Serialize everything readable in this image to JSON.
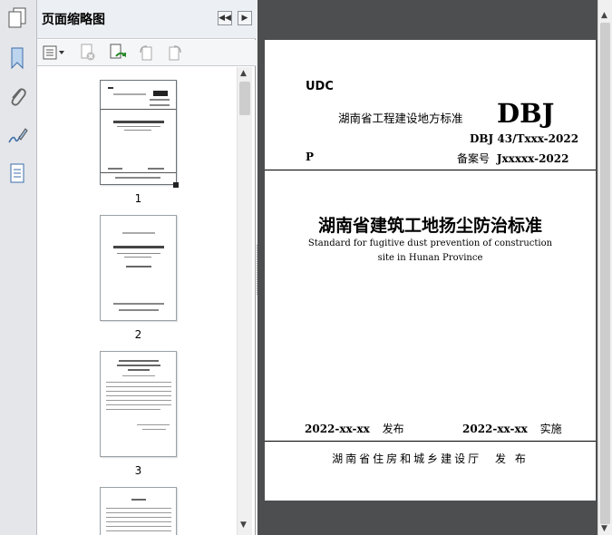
{
  "panel": {
    "title": "页面缩略图"
  },
  "thumbnails": [
    {
      "page": "1"
    },
    {
      "page": "2"
    },
    {
      "page": "3"
    }
  ],
  "document": {
    "udc": "UDC",
    "series": "湖南省工程建设地方标准",
    "logo": "DBJ",
    "std_no": "DBJ 43/Txxx-2022",
    "p": "P",
    "record_label": "备案号",
    "record_no": "Jxxxxx-2022",
    "title": "湖南省建筑工地扬尘防治标准",
    "title_en_1": "Standard for fugitive dust prevention of construction",
    "title_en_2": "site in Hunan Province",
    "issue_date": "2022-xx-xx",
    "issue_word": "发布",
    "impl_date": "2022-xx-xx",
    "impl_word": "实施",
    "publisher": "湖南省住房和城乡建设厅",
    "publisher_word": "发 布"
  },
  "icons": [
    "pages-icon",
    "bookmark-icon",
    "attachment-icon",
    "signature-icon",
    "layers-icon",
    "options-icon",
    "delete-page-icon",
    "insert-page-icon",
    "rotate-left-icon",
    "rotate-right-icon",
    "collapse-left-icon",
    "expand-right-icon"
  ]
}
